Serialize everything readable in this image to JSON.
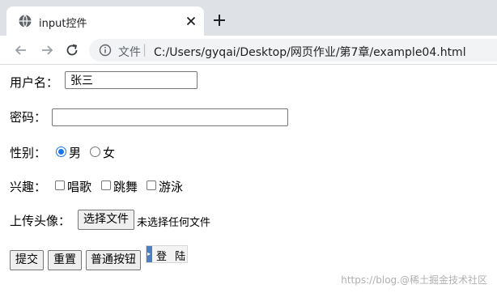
{
  "browser": {
    "tab_title": "input控件",
    "origin_label": "文件",
    "url": "C:/Users/gyqai/Desktop/网页作业/第7章/example04.html"
  },
  "form": {
    "username": {
      "label": "用户名：",
      "value": "张三"
    },
    "password": {
      "label": "密码：",
      "value": ""
    },
    "gender": {
      "label": "性别：",
      "options": [
        {
          "label": "男",
          "checked": true
        },
        {
          "label": "女",
          "checked": false
        }
      ]
    },
    "hobbies": {
      "label": "兴趣：",
      "options": [
        {
          "label": "唱歌",
          "checked": false
        },
        {
          "label": "跳舞",
          "checked": false
        },
        {
          "label": "游泳",
          "checked": false
        }
      ]
    },
    "avatar": {
      "label": "上传头像：",
      "button_label": "选择文件",
      "status": "未选择任何文件"
    },
    "buttons": {
      "submit": "提交",
      "reset": "重置",
      "normal": "普通按钮",
      "image_login": "登 陆"
    }
  },
  "watermark": "https://blog.@稀土掘金技术社区",
  "colors": {
    "tabstrip": "#dee1e6",
    "omnibox": "#f1f3f4",
    "radio_accent": "#1a73e8"
  },
  "icons": {
    "favicon": "globe-icon",
    "close": "close-icon",
    "new_tab": "plus-icon",
    "back": "back-arrow-icon",
    "forward": "forward-arrow-icon",
    "reload": "reload-icon",
    "info": "info-icon"
  }
}
